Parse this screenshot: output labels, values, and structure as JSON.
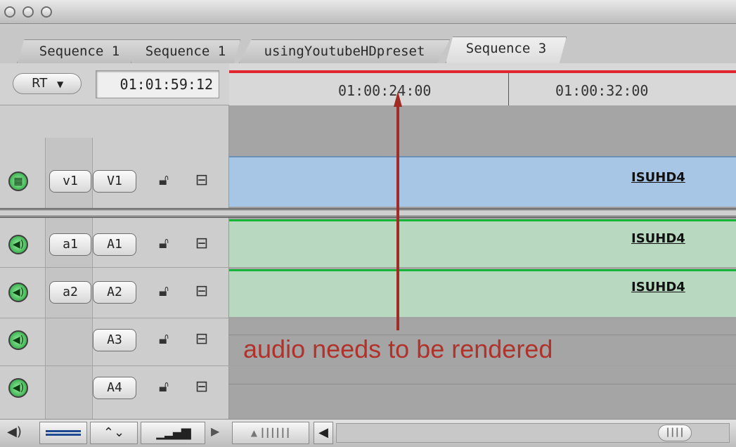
{
  "tabs": [
    {
      "label": "Sequence 1",
      "active": false
    },
    {
      "label": "Sequence 1",
      "active": false
    },
    {
      "label": "usingYoutubeHDpreset",
      "active": false
    },
    {
      "label": "Sequence 3",
      "active": true
    }
  ],
  "toolbar": {
    "rt_label": "RT",
    "timecode": "01:01:59:12"
  },
  "ruler": {
    "labels": [
      "01:00:24:00",
      "01:00:32:00"
    ],
    "render_color": "#e0262e"
  },
  "tracks": {
    "video": [
      {
        "src": "v1",
        "dest": "V1",
        "clip": "ISUHD4"
      }
    ],
    "audio": [
      {
        "src": "a1",
        "dest": "A1",
        "clip": "ISUHD4"
      },
      {
        "src": "a2",
        "dest": "A2",
        "clip": "ISUHD4"
      },
      {
        "src": "",
        "dest": "A3",
        "clip": ""
      },
      {
        "src": "",
        "dest": "A4",
        "clip": ""
      }
    ]
  },
  "annotation": {
    "text": "audio needs to be rendered",
    "color": "#b0322b"
  },
  "colors": {
    "video_clip": "#a7c6e6",
    "audio_clip": "#b8d9c0",
    "audio_render_line": "#18b43a"
  }
}
